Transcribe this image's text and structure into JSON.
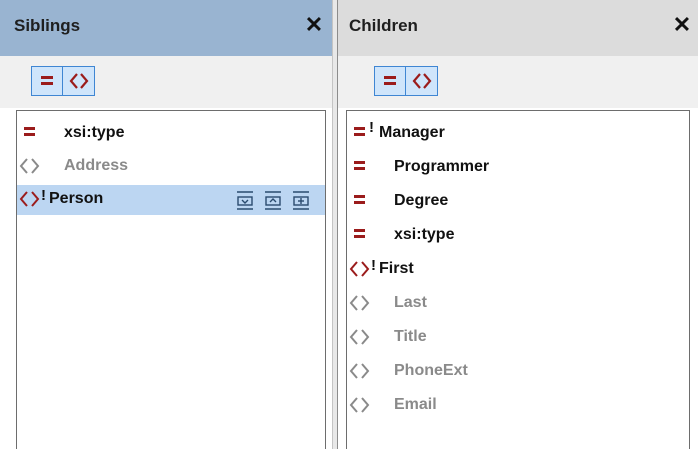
{
  "siblings": {
    "title": "Siblings",
    "close_label": "✕",
    "toolbar": {
      "attributes_filter": "attributes",
      "elements_filter": "elements"
    },
    "items": [
      {
        "label": "xsi:type",
        "kind": "attribute",
        "required": false,
        "enabled": true,
        "selected": false
      },
      {
        "label": "Address",
        "kind": "element",
        "required": false,
        "enabled": false,
        "selected": false
      },
      {
        "label": "Person",
        "kind": "element",
        "required": true,
        "enabled": true,
        "selected": true
      }
    ],
    "row_actions": [
      "insert-before-icon",
      "insert-after-icon",
      "insert-child-icon"
    ]
  },
  "children": {
    "title": "Children",
    "close_label": "✕",
    "toolbar": {
      "attributes_filter": "attributes",
      "elements_filter": "elements"
    },
    "items": [
      {
        "label": "Manager",
        "kind": "attribute",
        "required": true,
        "enabled": true
      },
      {
        "label": "Programmer",
        "kind": "attribute",
        "required": false,
        "enabled": true
      },
      {
        "label": "Degree",
        "kind": "attribute",
        "required": false,
        "enabled": true
      },
      {
        "label": "xsi:type",
        "kind": "attribute",
        "required": false,
        "enabled": true
      },
      {
        "label": "First",
        "kind": "element",
        "required": true,
        "enabled": true
      },
      {
        "label": "Last",
        "kind": "element",
        "required": false,
        "enabled": false
      },
      {
        "label": "Title",
        "kind": "element",
        "required": false,
        "enabled": false
      },
      {
        "label": "PhoneExt",
        "kind": "element",
        "required": false,
        "enabled": false
      },
      {
        "label": "Email",
        "kind": "element",
        "required": false,
        "enabled": false
      }
    ]
  },
  "colors": {
    "attribute_icon": "#9b1c1c",
    "element_icon_active": "#9b1c1c",
    "element_icon_disabled": "#8a8a8a",
    "selection": "#bcd6f2",
    "active_title": "#99b4d1",
    "inactive_title": "#dcdcdc",
    "toggle_border": "#3f86d3",
    "toggle_fill": "#cfe5fb"
  }
}
